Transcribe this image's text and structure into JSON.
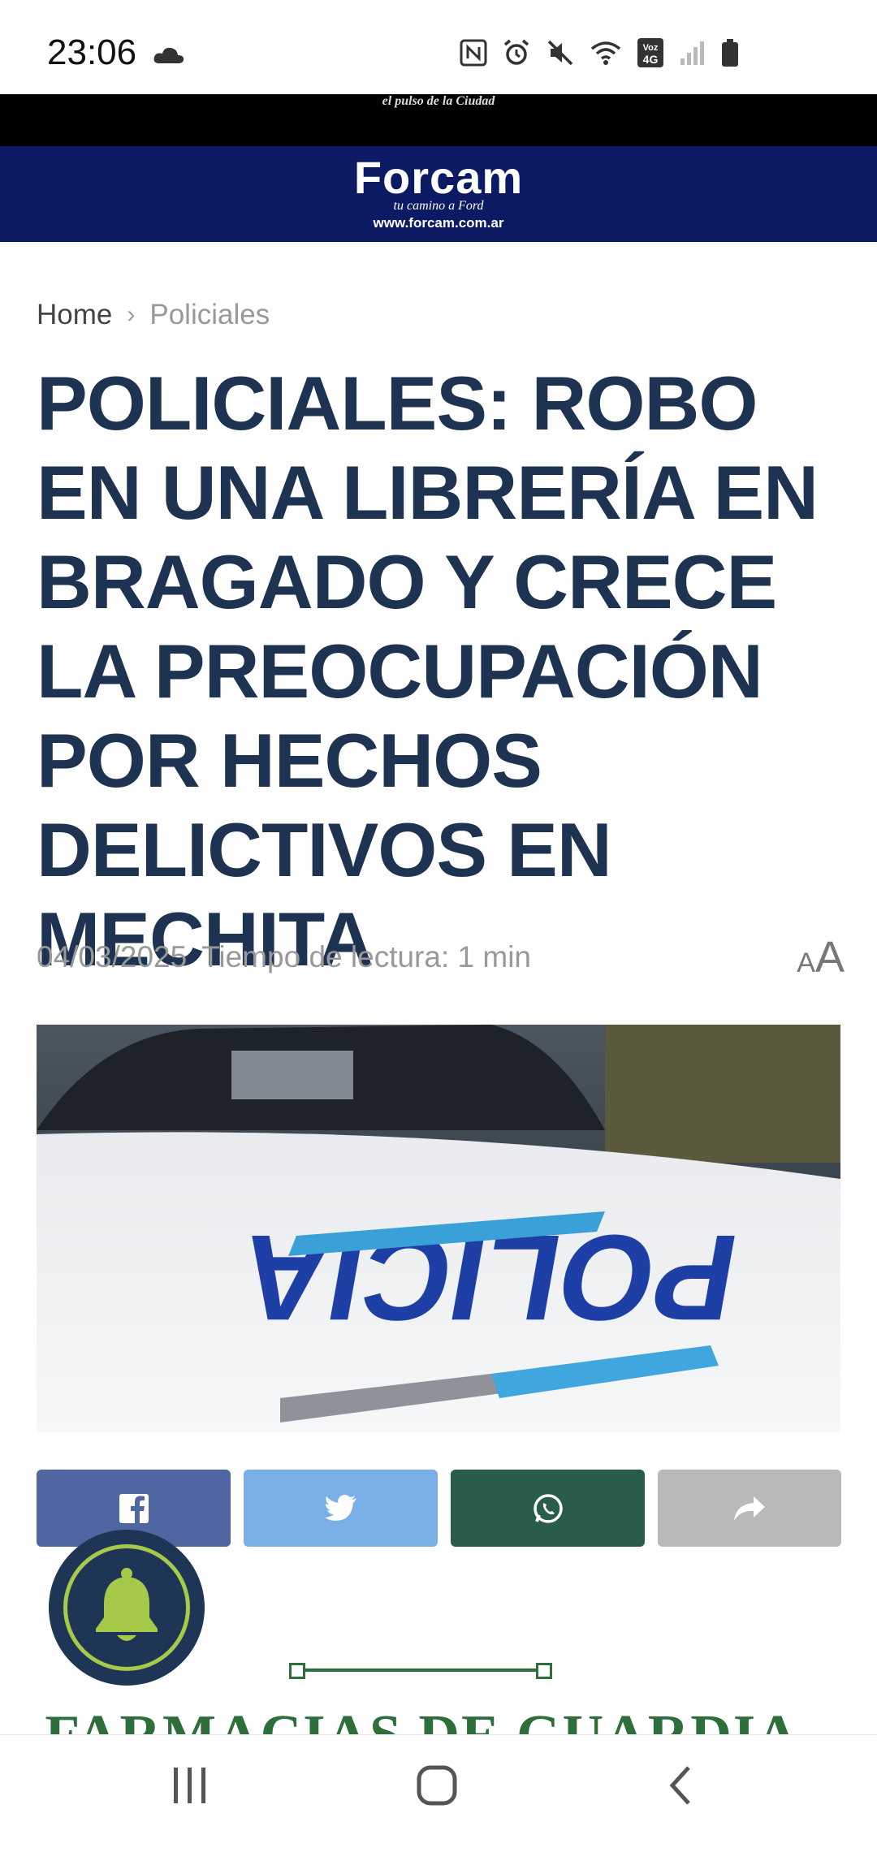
{
  "status_bar": {
    "time": "23:06"
  },
  "site": {
    "tagline": "el pulso de la Ciudad"
  },
  "banner": {
    "brand": "Forcam",
    "sub": "tu camino a Ford",
    "url": "www.forcam.com.ar"
  },
  "breadcrumb": {
    "home": "Home",
    "current": "Policiales"
  },
  "article": {
    "title": "POLICIALES: ROBO EN UNA LIBRERÍA EN BRAGADO Y CRECE LA PREOCUPACIÓN POR HECHOS DELICTIVOS EN MECHITA",
    "date": "04/03/2025",
    "reading_time": "Tiempo de lectura: 1 min",
    "font_small": "A",
    "font_big": "A",
    "image_text": "POLICIA"
  },
  "share": {
    "facebook_icon": "facebook-icon",
    "twitter_icon": "twitter-icon",
    "whatsapp_icon": "whatsapp-icon",
    "share_icon": "share-icon"
  },
  "ad": {
    "text": "FARMACIAS DE GUARDIA"
  },
  "colors": {
    "title": "#1e3352",
    "banner": "#0c1a63",
    "facebook": "#4f66a0",
    "twitter": "#79aee6",
    "whatsapp": "#2a5c4b",
    "share": "#b9b9b9",
    "bell_bg": "#1f3556",
    "bell_accent": "#a6c94a"
  }
}
